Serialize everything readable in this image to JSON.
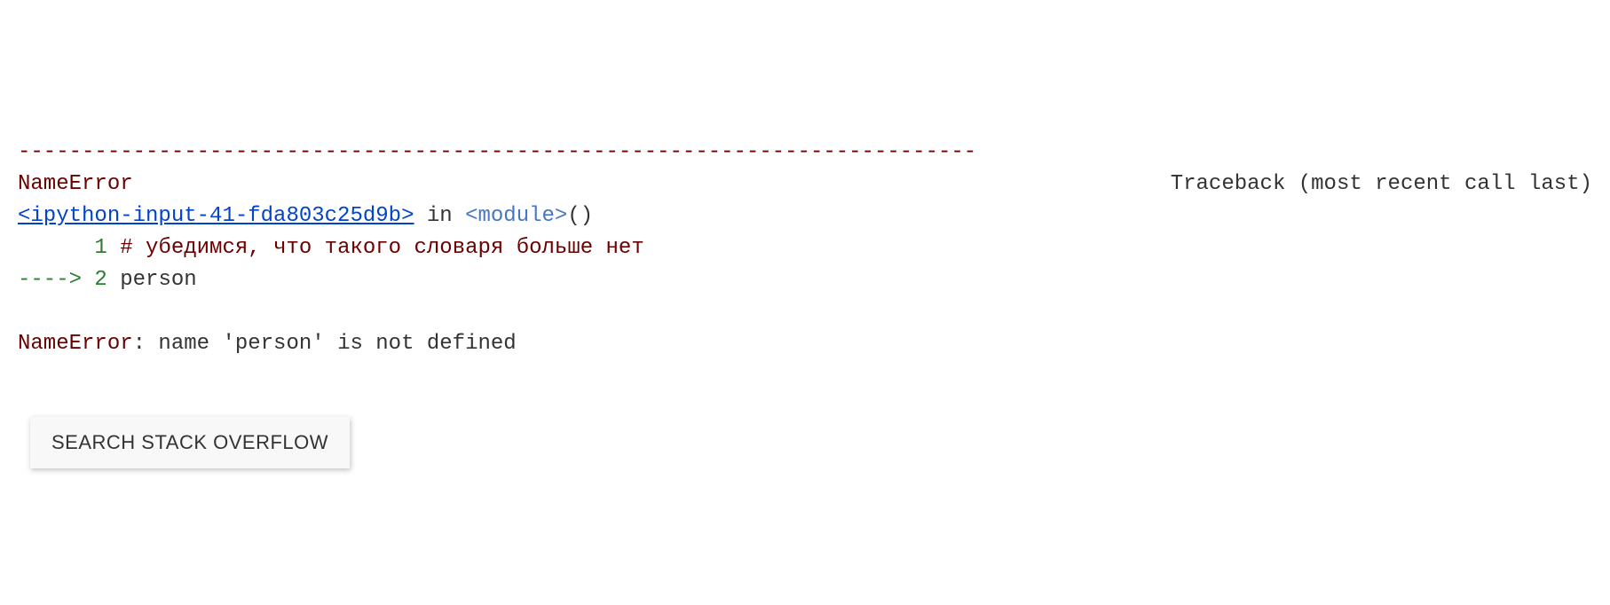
{
  "traceback": {
    "separator": "---------------------------------------------------------------------------",
    "error_type": "NameError",
    "traceback_label": "Traceback (most recent call last)",
    "source_link": "<ipython-input-41-fda803c25d9b>",
    "in_word": " in ",
    "module": "<module>",
    "parens": "()",
    "lines": [
      {
        "prefix": "      ",
        "number": "1",
        "space": " ",
        "comment": "# убедимся, что такого словаря больше нет"
      },
      {
        "arrow": "----> ",
        "number": "2",
        "space": " ",
        "code": "person"
      }
    ],
    "error_final": {
      "name": "NameError",
      "message": ": name 'person' is not defined"
    }
  },
  "buttons": {
    "search_stackoverflow": "SEARCH STACK OVERFLOW"
  }
}
